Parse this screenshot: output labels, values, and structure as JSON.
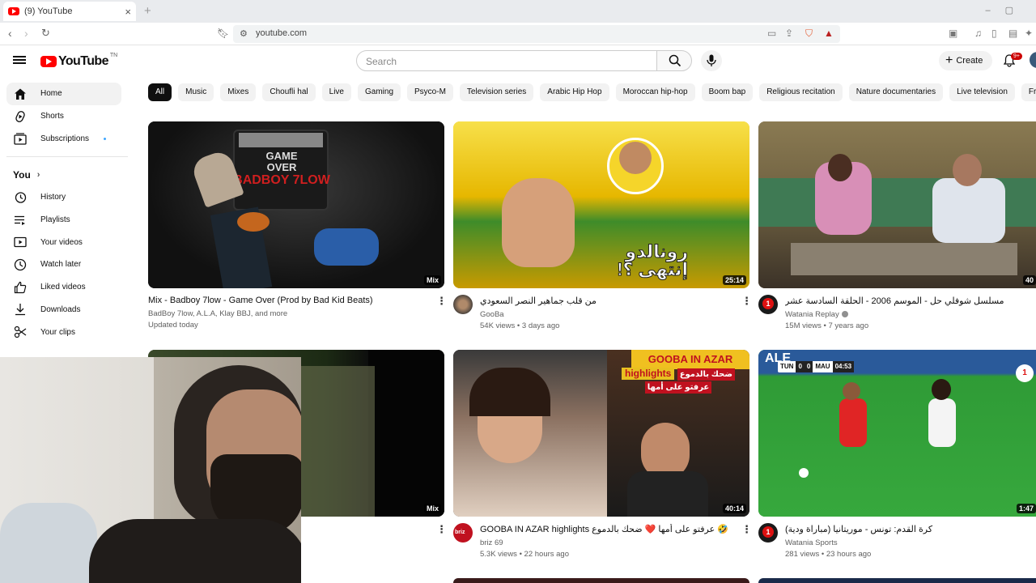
{
  "browser": {
    "tab_title": "(9) YouTube",
    "url": "youtube.com"
  },
  "header": {
    "logo_text": "YouTube",
    "logo_country": "TN",
    "search_placeholder": "Search",
    "create_label": "Create",
    "notifications_badge": "9+"
  },
  "sidebar": {
    "items": [
      {
        "label": "Home",
        "icon": "home-icon"
      },
      {
        "label": "Shorts",
        "icon": "shorts-icon"
      },
      {
        "label": "Subscriptions",
        "icon": "subscriptions-icon"
      }
    ],
    "you_label": "You",
    "you_items": [
      {
        "label": "History",
        "icon": "history-icon"
      },
      {
        "label": "Playlists",
        "icon": "playlists-icon"
      },
      {
        "label": "Your videos",
        "icon": "your-videos-icon"
      },
      {
        "label": "Watch later",
        "icon": "watch-later-icon"
      },
      {
        "label": "Liked videos",
        "icon": "liked-videos-icon"
      },
      {
        "label": "Downloads",
        "icon": "downloads-icon"
      },
      {
        "label": "Your clips",
        "icon": "clips-icon"
      }
    ]
  },
  "chips": [
    "All",
    "Music",
    "Mixes",
    "Choufli hal",
    "Live",
    "Gaming",
    "Psyco-M",
    "Television series",
    "Arabic Hip Hop",
    "Moroccan hip-hop",
    "Boom bap",
    "Religious recitation",
    "Nature documentaries",
    "Live television",
    "Free"
  ],
  "videos": [
    {
      "title": "Mix - Badboy 7low - Game Over (Prod by Bad Kid Beats)",
      "channel": "BadBoy 7low, A.L.A, Klay BBJ, and more",
      "stats": "Updated today",
      "badge": "Mix",
      "thumb_text": [
        "GAME",
        "OVER",
        "BADBOY 7LOW"
      ]
    },
    {
      "title": "من قلب جماهير النصر السعودي",
      "channel": "GooBa",
      "stats": "54K views • 3 days ago",
      "badge": "25:14",
      "thumb_text": [
        "رونالدو",
        "إنتهى ؟!"
      ]
    },
    {
      "title": "مسلسل شوفلي حل - الموسم 2006 - الحلقة السادسة عشر",
      "channel": "Watania Replay",
      "stats": "15M views • 7 years ago",
      "badge": "40"
    },
    {
      "title": "",
      "channel": "",
      "stats": "",
      "badge": "Mix"
    },
    {
      "title": "GOOBA IN AZAR highlights عرفتو على أمها ❤️ ضحك بالدموع 🤣 ❤️",
      "channel": "briz 69",
      "stats": "5.3K views • 22 hours ago",
      "badge": "40:14",
      "thumb_text": [
        "GOOBA IN AZAR",
        "highlights",
        "ضحك بالدموع",
        "عرفتو على أمها"
      ]
    },
    {
      "title": "كرة القدم: تونس - موريتانيا (مباراة ودية)",
      "channel": "Watania Sports",
      "stats": "281 views • 23 hours ago",
      "badge": "1:47",
      "thumb_text": [
        "TUN",
        "0",
        "0",
        "MAU",
        "04:53",
        "ALE"
      ]
    }
  ]
}
